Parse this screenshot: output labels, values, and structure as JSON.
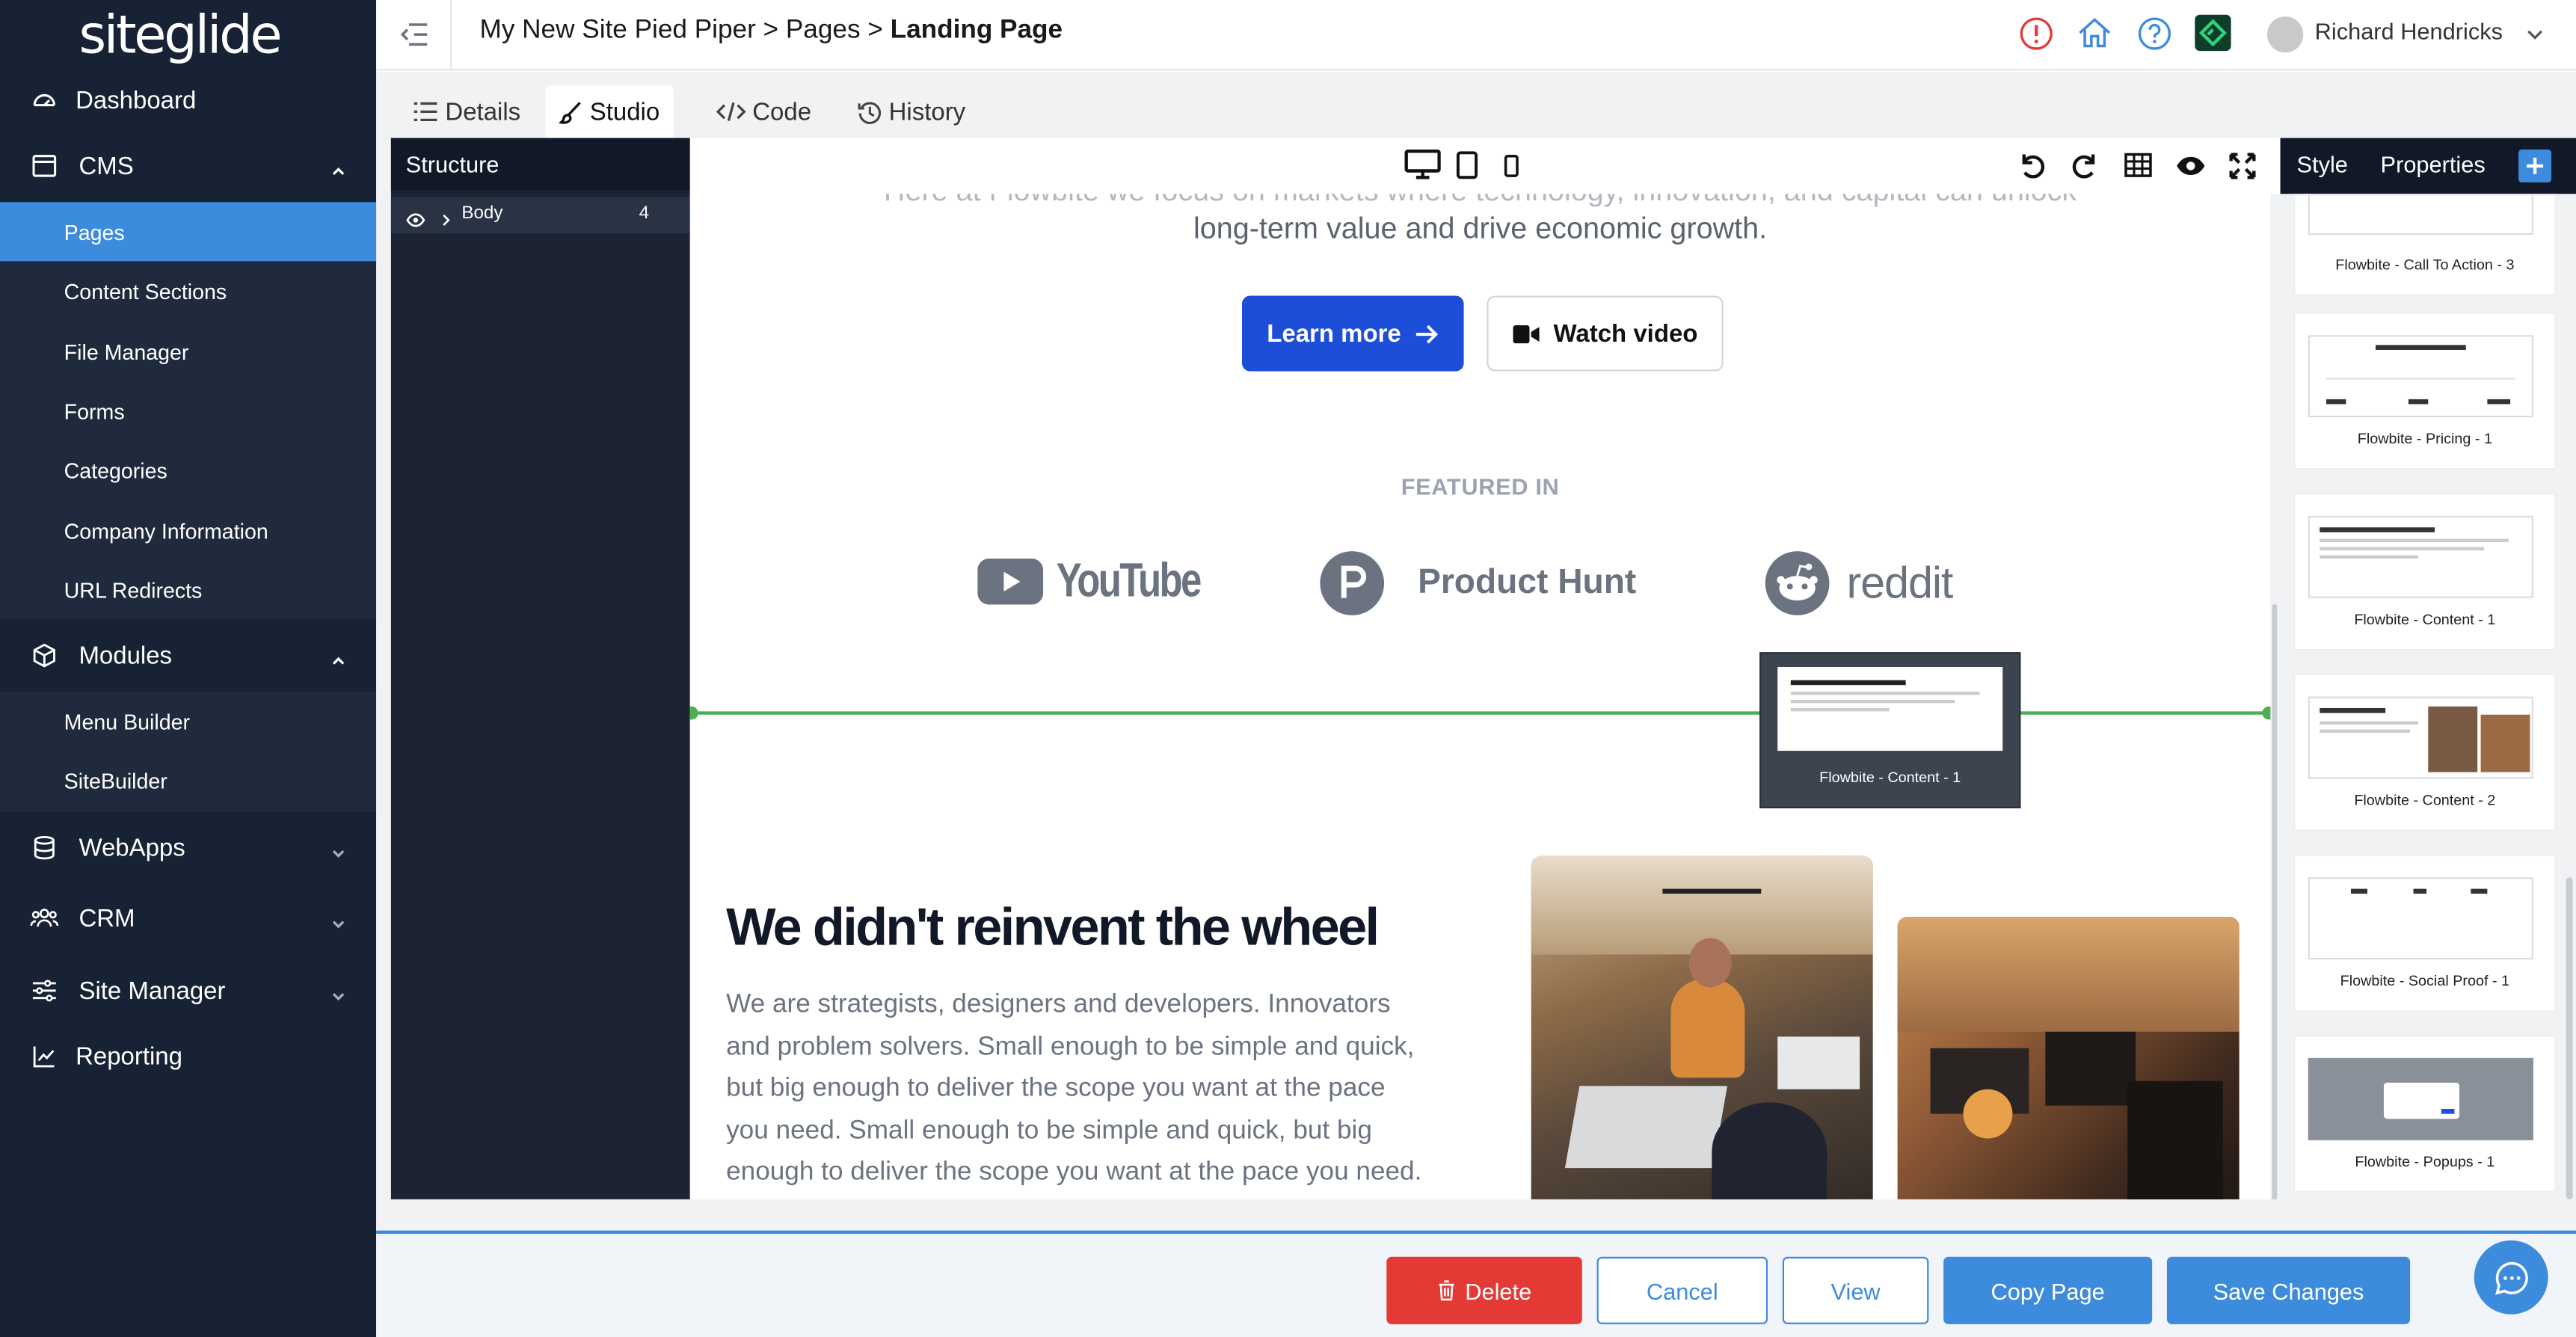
{
  "app": {
    "logo": "siteglide"
  },
  "sidebar": {
    "dashboard": "Dashboard",
    "cms": {
      "label": "CMS",
      "items": [
        "Pages",
        "Content Sections",
        "File Manager",
        "Forms",
        "Categories",
        "Company Information",
        "URL Redirects"
      ],
      "active": "Pages"
    },
    "modules": {
      "label": "Modules",
      "items": [
        "Menu Builder",
        "SiteBuilder"
      ]
    },
    "webapps": "WebApps",
    "crm": "CRM",
    "site_manager": "Site Manager",
    "reporting": "Reporting"
  },
  "header": {
    "breadcrumb_prefix": "My New Site Pied Piper > Pages > ",
    "breadcrumb_current": "Landing Page",
    "user_name": "Richard Hendricks",
    "colors": {
      "alert": "#e53935",
      "home": "#3d8bdd",
      "help": "#3d8bdd",
      "extension": "#1ba05a"
    }
  },
  "tabs": [
    "Details",
    "Studio",
    "Code",
    "History"
  ],
  "active_tab": "Studio",
  "structure": {
    "title": "Structure",
    "node": "Body",
    "count": "4"
  },
  "right_panel": {
    "tabs": [
      "Style",
      "Properties"
    ],
    "blocks": [
      "Flowbite - Call To Action - 3",
      "Flowbite - Pricing - 1",
      "Flowbite - Content - 1",
      "Flowbite - Content - 2",
      "Flowbite - Social Proof - 1",
      "Flowbite - Popups - 1"
    ]
  },
  "canvas": {
    "hero_partial": "Here at Flowbite we focus on markets where technology, innovation, and capital can unlock",
    "hero_line": "long-term value and drive economic growth.",
    "learn_more": "Learn more",
    "watch_video": "Watch video",
    "featured_in": "FEATURED IN",
    "logos": [
      "YouTube",
      "Product Hunt",
      "reddit"
    ],
    "drag_preview": "Flowbite - Content - 1",
    "heading": "We didn't reinvent the wheel",
    "paragraph_lines": [
      "We are strategists, designers and developers. Innovators",
      "and problem solvers. Small enough to be simple and quick,",
      "but big enough to deliver the scope you want at the pace",
      "you need. Small enough to be simple and quick, but big",
      "enough to deliver the scope you want at the pace you need."
    ],
    "accent": "#1d4ed8"
  },
  "footer": {
    "delete": "Delete",
    "cancel": "Cancel",
    "view": "View",
    "copy": "Copy Page",
    "save": "Save Changes"
  }
}
